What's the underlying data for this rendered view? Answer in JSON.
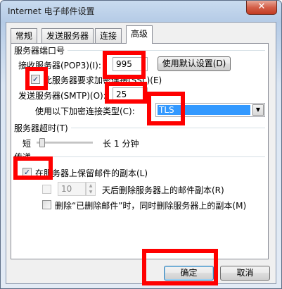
{
  "window": {
    "title": "Internet 电子邮件设置",
    "close_glyph": "✕"
  },
  "tabs": [
    {
      "label": "常规",
      "active": false
    },
    {
      "label": "发送服务器",
      "active": false
    },
    {
      "label": "连接",
      "active": false
    },
    {
      "label": "高级",
      "active": true
    }
  ],
  "ports": {
    "group_title": "服务器端口号",
    "incoming_label": "接收服务器(POP3)(I):",
    "incoming_value": "995",
    "default_button": "使用默认设置(D)",
    "ssl_checkbox_label": "此服务器要求加密连接(SSL)(E)",
    "ssl_checked": true,
    "outgoing_label": "发送服务器(SMTP)(O):",
    "outgoing_value": "25",
    "encryption_label": "使用以下加密连接类型(C):",
    "encryption_value": "TLS"
  },
  "timeout": {
    "group_title": "服务器超时(T)",
    "short_label": "短",
    "long_label": "长",
    "value_label": "1 分钟",
    "level": 0.05
  },
  "delivery": {
    "group_title": "传递",
    "keep_copy_label": "在服务器上保留邮件的副本(L)",
    "keep_copy_checked": true,
    "remove_days_value": "10",
    "remove_after_label": "天后删除服务器上的邮件副本(R)",
    "remove_when_deleted_label": "删除“已删除邮件”时，同时删除服务器上的副本(M)"
  },
  "footer": {
    "ok_label": "确定",
    "cancel_label": "取消"
  },
  "colors": {
    "annotation_red": "#ff0000",
    "selection_blue": "#3399ff"
  }
}
